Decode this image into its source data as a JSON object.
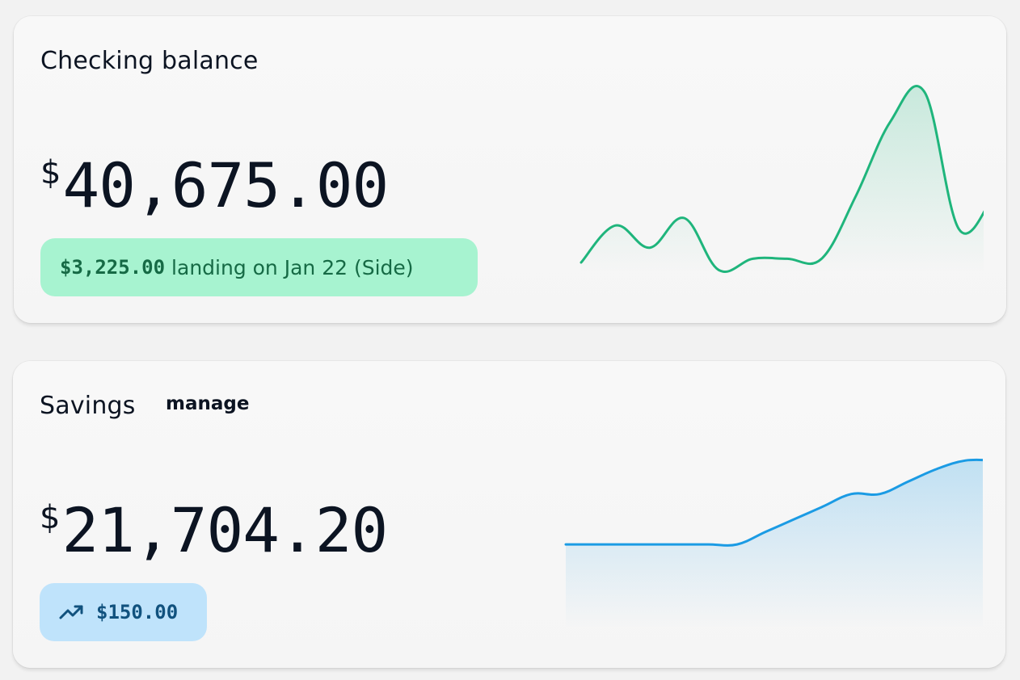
{
  "accounts": [
    {
      "title": "Checking balance",
      "currency_symbol": "$",
      "amount": "40,675.00",
      "pill": {
        "amount": "$3,225.00",
        "text": "landing on Jan 22 (Side)"
      },
      "trend_points": [
        12,
        22,
        16,
        24,
        10,
        13,
        13,
        13,
        30,
        50,
        58,
        21,
        30
      ],
      "color": "#1fb57c",
      "fill_color": "#cdeedd"
    },
    {
      "title": "Savings",
      "manage_label": "manage",
      "currency_symbol": "$",
      "amount": "21,704.20",
      "pill": {
        "icon": "trending-up-icon",
        "amount": "$150.00"
      },
      "trend_points": [
        10,
        10,
        10,
        10,
        10,
        10,
        10,
        13,
        16,
        19,
        22,
        22,
        25,
        28,
        30,
        30
      ],
      "color": "#1b9be4",
      "fill_color": "#c9e3f4"
    }
  ]
}
